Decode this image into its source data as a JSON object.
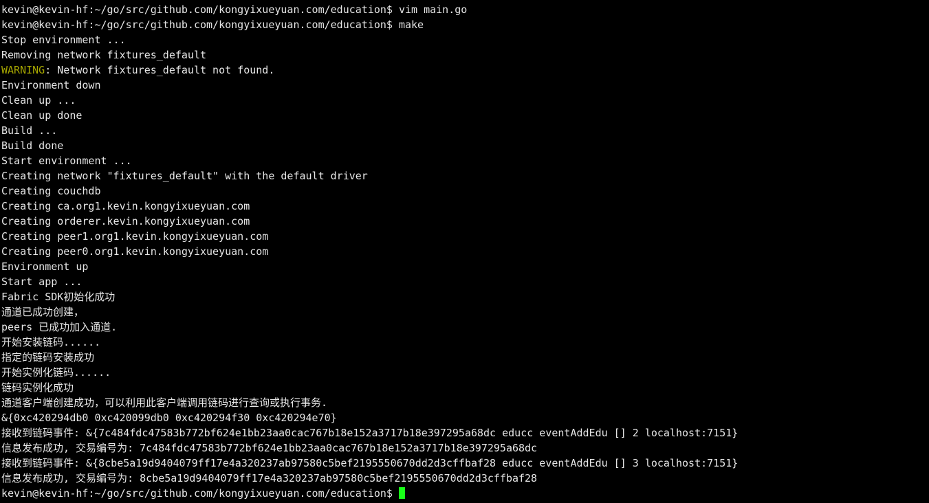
{
  "terminal": {
    "background_color": "#000000",
    "foreground_color": "#e6e6e6",
    "warning_color": "#a6a600",
    "cursor_color": "#18ff18",
    "prompt": "kevin@kevin-hf:~/go/src/github.com/kongyixueyuan.com/education$",
    "lines": [
      {
        "id": "line-1",
        "segments": [
          {
            "text": "kevin@kevin-hf:~/go/src/github.com/kongyixueyuan.com/education$ vim main.go",
            "color": "default"
          }
        ]
      },
      {
        "id": "line-2",
        "segments": [
          {
            "text": "kevin@kevin-hf:~/go/src/github.com/kongyixueyuan.com/education$ make",
            "color": "default"
          }
        ]
      },
      {
        "id": "line-3",
        "segments": [
          {
            "text": "Stop environment ...",
            "color": "default"
          }
        ]
      },
      {
        "id": "line-4",
        "segments": [
          {
            "text": "Removing network fixtures_default",
            "color": "default"
          }
        ]
      },
      {
        "id": "line-5",
        "segments": [
          {
            "text": "WARNING",
            "color": "warn"
          },
          {
            "text": ": Network fixtures_default not found.",
            "color": "default"
          }
        ]
      },
      {
        "id": "line-6",
        "segments": [
          {
            "text": "Environment down",
            "color": "default"
          }
        ]
      },
      {
        "id": "line-7",
        "segments": [
          {
            "text": "Clean up ...",
            "color": "default"
          }
        ]
      },
      {
        "id": "line-8",
        "segments": [
          {
            "text": "Clean up done",
            "color": "default"
          }
        ]
      },
      {
        "id": "line-9",
        "segments": [
          {
            "text": "Build ...",
            "color": "default"
          }
        ]
      },
      {
        "id": "line-10",
        "segments": [
          {
            "text": "Build done",
            "color": "default"
          }
        ]
      },
      {
        "id": "line-11",
        "segments": [
          {
            "text": "Start environment ...",
            "color": "default"
          }
        ]
      },
      {
        "id": "line-12",
        "segments": [
          {
            "text": "Creating network \"fixtures_default\" with the default driver",
            "color": "default"
          }
        ]
      },
      {
        "id": "line-13",
        "segments": [
          {
            "text": "Creating couchdb",
            "color": "default"
          }
        ]
      },
      {
        "id": "line-14",
        "segments": [
          {
            "text": "Creating ca.org1.kevin.kongyixueyuan.com",
            "color": "default"
          }
        ]
      },
      {
        "id": "line-15",
        "segments": [
          {
            "text": "Creating orderer.kevin.kongyixueyuan.com",
            "color": "default"
          }
        ]
      },
      {
        "id": "line-16",
        "segments": [
          {
            "text": "Creating peer1.org1.kevin.kongyixueyuan.com",
            "color": "default"
          }
        ]
      },
      {
        "id": "line-17",
        "segments": [
          {
            "text": "Creating peer0.org1.kevin.kongyixueyuan.com",
            "color": "default"
          }
        ]
      },
      {
        "id": "line-18",
        "segments": [
          {
            "text": "Environment up",
            "color": "default"
          }
        ]
      },
      {
        "id": "line-19",
        "segments": [
          {
            "text": "Start app ...",
            "color": "default"
          }
        ]
      },
      {
        "id": "line-20",
        "segments": [
          {
            "text": "Fabric SDK初始化成功",
            "color": "default"
          }
        ]
      },
      {
        "id": "line-21",
        "segments": [
          {
            "text": "通道已成功创建，",
            "color": "default"
          }
        ]
      },
      {
        "id": "line-22",
        "segments": [
          {
            "text": "peers 已成功加入通道.",
            "color": "default"
          }
        ]
      },
      {
        "id": "line-23",
        "segments": [
          {
            "text": "开始安装链码......",
            "color": "default"
          }
        ]
      },
      {
        "id": "line-24",
        "segments": [
          {
            "text": "指定的链码安装成功",
            "color": "default"
          }
        ]
      },
      {
        "id": "line-25",
        "segments": [
          {
            "text": "开始实例化链码......",
            "color": "default"
          }
        ]
      },
      {
        "id": "line-26",
        "segments": [
          {
            "text": "链码实例化成功",
            "color": "default"
          }
        ]
      },
      {
        "id": "line-27",
        "segments": [
          {
            "text": "通道客户端创建成功，可以利用此客户端调用链码进行查询或执行事务.",
            "color": "default"
          }
        ]
      },
      {
        "id": "line-28",
        "segments": [
          {
            "text": "&{0xc420294db0 0xc420099db0 0xc420294f30 0xc420294e70}",
            "color": "default"
          }
        ]
      },
      {
        "id": "line-29",
        "segments": [
          {
            "text": "接收到链码事件: &{7c484fdc47583b772bf624e1bb23aa0cac767b18e152a3717b18e397295a68dc educc eventAddEdu [] 2 localhost:7151}",
            "color": "default"
          }
        ]
      },
      {
        "id": "line-30",
        "segments": [
          {
            "text": "信息发布成功, 交易编号为: 7c484fdc47583b772bf624e1bb23aa0cac767b18e152a3717b18e397295a68dc",
            "color": "default"
          }
        ]
      },
      {
        "id": "line-31",
        "segments": [
          {
            "text": "接收到链码事件: &{8cbe5a19d9404079ff17e4a320237ab97580c5bef2195550670dd2d3cffbaf28 educc eventAddEdu [] 3 localhost:7151}",
            "color": "default"
          }
        ]
      },
      {
        "id": "line-32",
        "segments": [
          {
            "text": "信息发布成功, 交易编号为: 8cbe5a19d9404079ff17e4a320237ab97580c5bef2195550670dd2d3cffbaf28",
            "color": "default"
          }
        ]
      },
      {
        "id": "line-33",
        "segments": [
          {
            "text": "kevin@kevin-hf:~/go/src/github.com/kongyixueyuan.com/education$ ",
            "color": "default"
          }
        ],
        "cursor": true
      }
    ]
  }
}
